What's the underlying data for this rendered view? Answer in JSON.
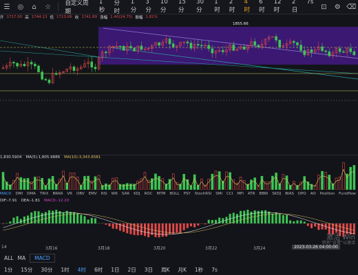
{
  "toolbar": {
    "custom_period": "自定义周期",
    "periods": [
      "1秒",
      "分时",
      "1分",
      "3分",
      "10分",
      "15分",
      "30分",
      "1时",
      "2时",
      "4时",
      "6时",
      "12时",
      "2日",
      "7s"
    ],
    "active_period": "4时",
    "icons": [
      "cursor-icon",
      "target-icon",
      "home-icon",
      "star-icon",
      "fullscreen-icon",
      "camera-icon",
      "gear-icon",
      "trash-icon"
    ]
  },
  "quote": {
    "open_label": "开",
    "open": "1717.00",
    "high_label": "高",
    "high": "1744.13",
    "low_label": "低",
    "low": "1713.06",
    "close_label": "收",
    "close": "1741.89",
    "change_label": "涨幅",
    "change": "1.40(24.75)",
    "amp_label": "振幅",
    "amp": "1.81%"
  },
  "price_marker": "1855.66",
  "volume": {
    "vol": "1,830.5904",
    "ma5": "MA(5):1,805.9886",
    "ma10": "MA(10):3,343.6581"
  },
  "indicators": [
    "MACD",
    "DMI",
    "DMA",
    "TRIX",
    "BRAR",
    "VR",
    "OBV",
    "EMV",
    "RSI",
    "WR",
    "SAR",
    "KDJ",
    "ROC",
    "MTM",
    "BOLL",
    "PSY",
    "StochRSI",
    "SMI",
    "CCI",
    "MFI",
    "ATR",
    "BBW",
    "SKDJ",
    "BIAS",
    "DPO",
    "AO",
    "Position",
    "Fundflow"
  ],
  "macd_values": {
    "dif": "DIF:-7.91",
    "dea": "DEA:-1.81",
    "macd": "MACD:-12.20"
  },
  "date_axis": {
    "labels": [
      "14",
      "3月16",
      "3月18",
      "3月20",
      "3月22",
      "3月24"
    ],
    "cursor": "2023-03-26 04:00:00"
  },
  "bottom_bar": {
    "all": "ALL",
    "ma": "MA",
    "macd": "MACD"
  },
  "bottom_periods": [
    "1分",
    "15分",
    "30分",
    "1时",
    "4时",
    "6时",
    "1日",
    "2日",
    "3日",
    "周K",
    "月K",
    "1秒",
    "7s"
  ],
  "bottom_active": "4时",
  "watermark": "激活 Win",
  "watermark_sub": "转到“设置”以激活",
  "colors": {
    "up": "#e04a4a",
    "down": "#3ec454",
    "accent": "#f0a020",
    "blue": "#4aa0ff",
    "purple": "#5a1fa0"
  }
}
